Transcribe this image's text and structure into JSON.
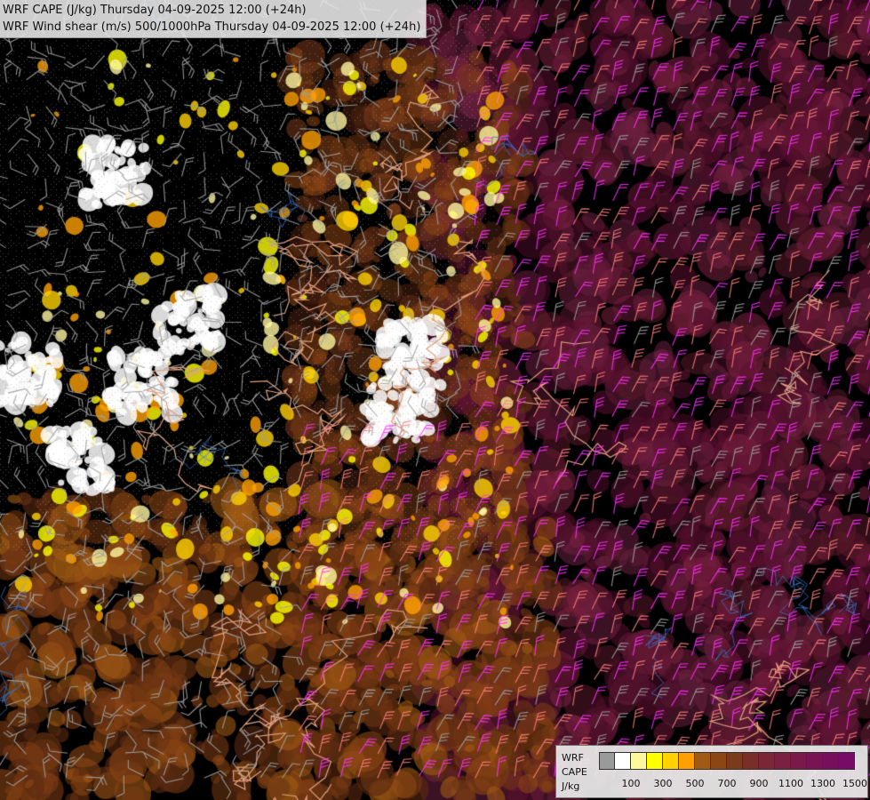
{
  "titles": {
    "line1": "WRF CAPE (J/kg) Thursday 04-09-2025 12:00 (+24h)",
    "line2": "WRF Wind shear (m/s) 500/1000hPa Thursday 04-09-2025 12:00 (+24h)"
  },
  "legend": {
    "label_line1": "WRF",
    "label_line2": "CAPE",
    "label_line3": "J/kg",
    "swatch_colors": [
      "#9a9a9a",
      "#ffffff",
      "#fff7a0",
      "#ffff00",
      "#ffd200",
      "#ffa000",
      "#a05a14",
      "#8c4614",
      "#7a3a1c",
      "#7a2e28",
      "#7a2636",
      "#7a2040",
      "#7a1a4a",
      "#781454",
      "#780e5e",
      "#780a68"
    ],
    "ticks": [
      "100",
      "300",
      "500",
      "700",
      "900",
      "1100",
      "1300",
      "1500"
    ]
  },
  "colors": {
    "background": "#000000",
    "border_line": "#e0a080",
    "barb_grey": "#a0a0a0",
    "barb_pink": "#ff8080",
    "barb_magenta": "#ff30ff"
  }
}
